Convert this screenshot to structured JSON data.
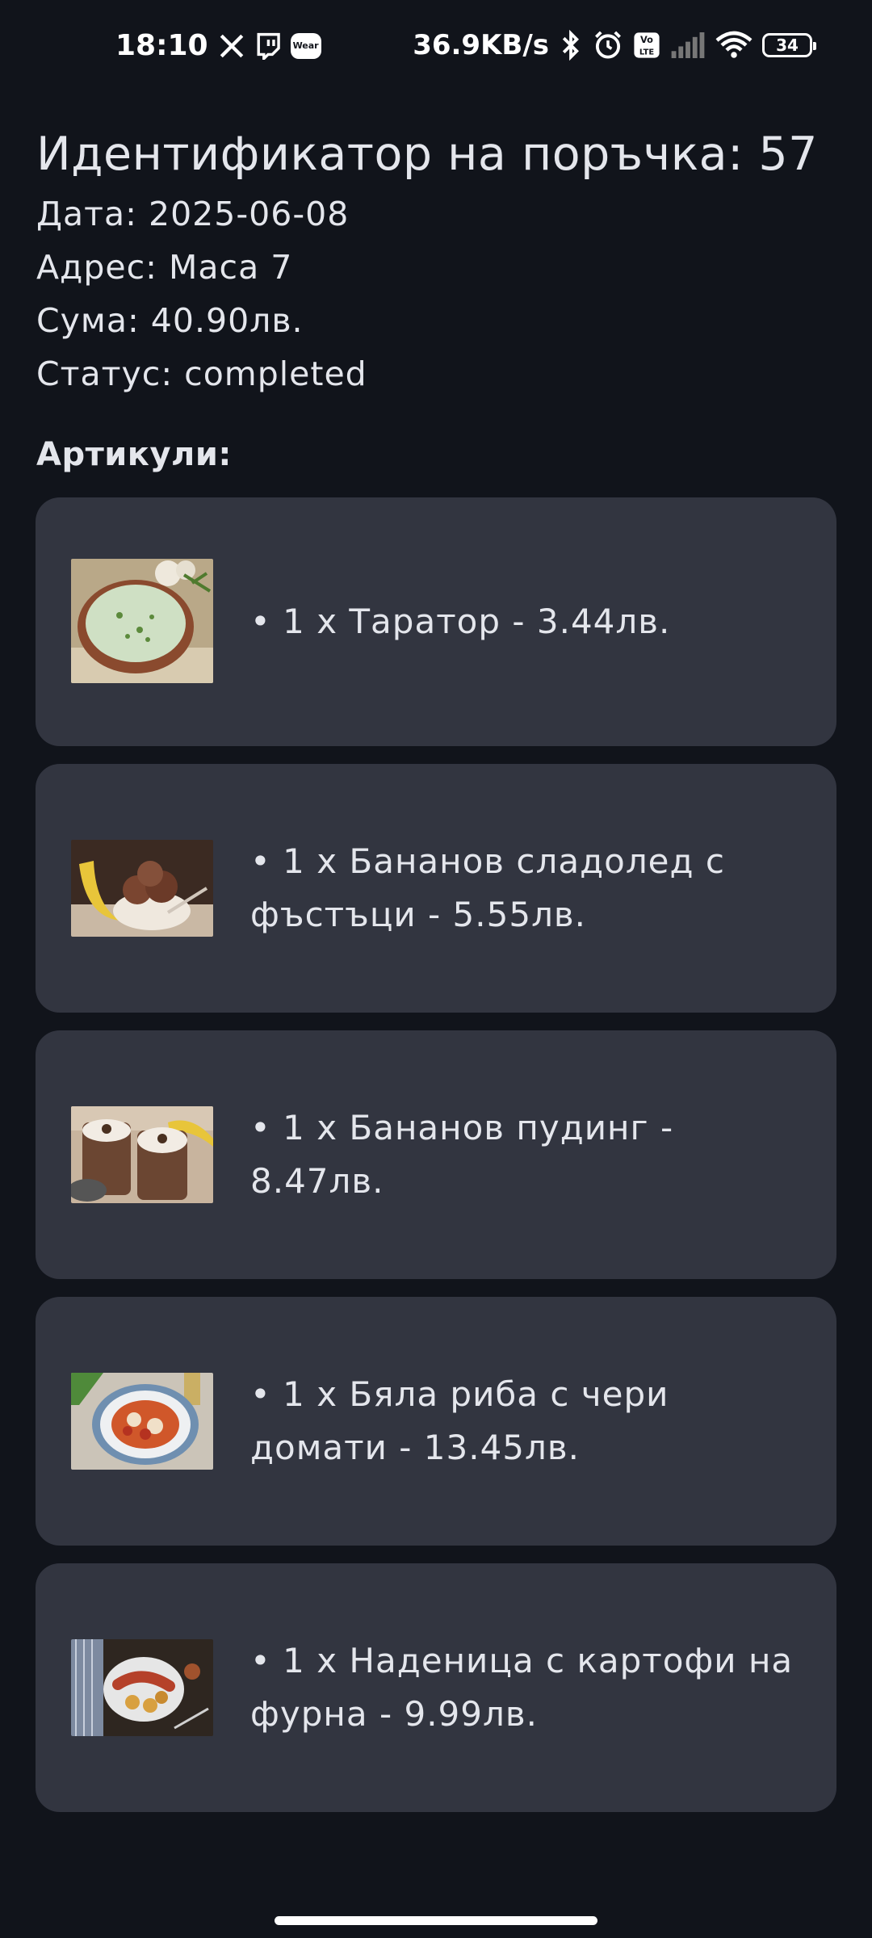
{
  "status_bar": {
    "time": "18:10",
    "left_icons": [
      "x-icon",
      "twitch-icon",
      "wear-icon"
    ],
    "wear_label": "Wear",
    "network_speed": "36.9KB/s",
    "volte_label": "Vo LTE",
    "battery_level": "34",
    "right_icons": [
      "bluetooth-icon",
      "alarm-icon",
      "volte-icon",
      "signal-icon",
      "wifi-icon",
      "battery-icon"
    ]
  },
  "order": {
    "title": "Идентификатор на поръчка: 57",
    "date": "Дата: 2025-06-08",
    "address": "Адрес: Маса 7",
    "total": "Сума: 40.90лв.",
    "status": "Статус: completed"
  },
  "items_heading": "Артикули:",
  "items": [
    {
      "text": "• 1 x Таратор - 3.44лв.",
      "image": "tarator-photo"
    },
    {
      "text": "• 1 x Бананов сладолед с фъстъци - 5.55лв.",
      "image": "banana-ice-cream-photo"
    },
    {
      "text": "• 1 x Бананов пудинг - 8.47лв.",
      "image": "banana-pudding-photo"
    },
    {
      "text": "• 1 x Бяла риба с чери домати - 13.45лв.",
      "image": "white-fish-photo"
    },
    {
      "text": "• 1 x Наденица с картофи на фурна - 9.99лв.",
      "image": "sausage-potatoes-photo"
    }
  ],
  "colors": {
    "background": "#11141b",
    "card": "#323540",
    "text": "#e4e6ec"
  }
}
